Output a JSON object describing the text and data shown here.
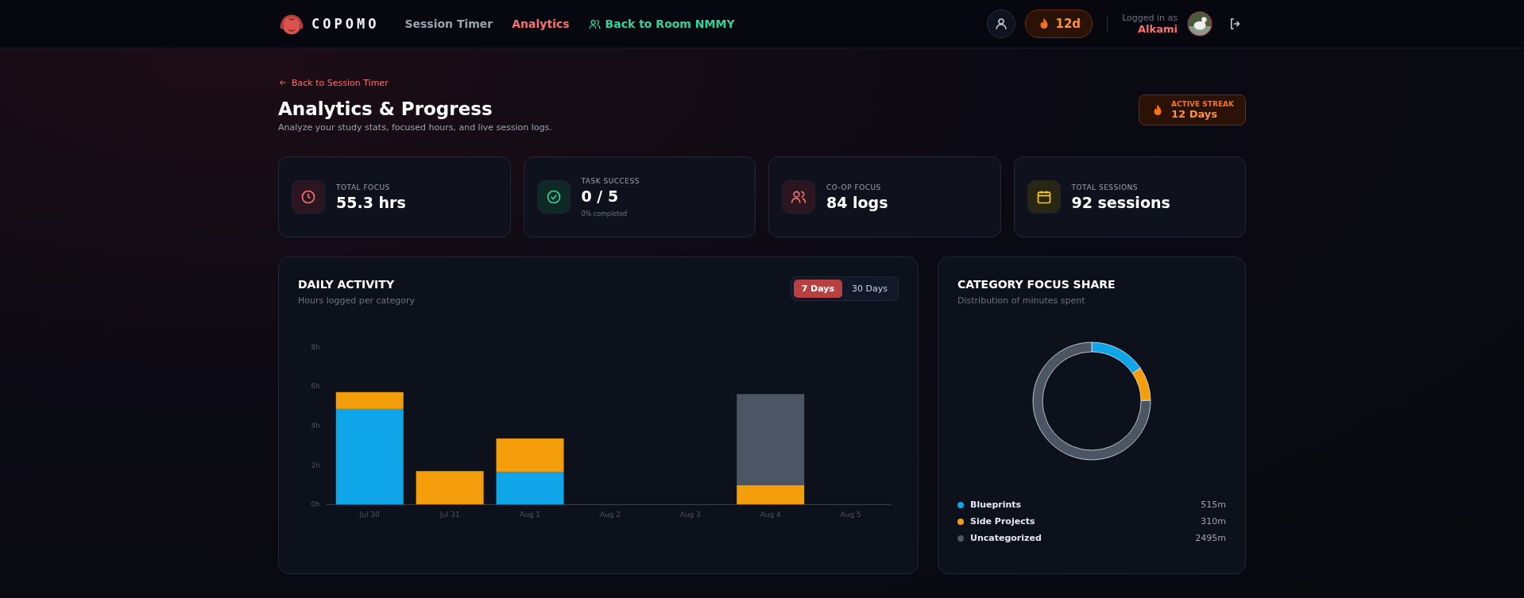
{
  "header": {
    "brand": "COPOMO",
    "nav": [
      {
        "label": "Session Timer",
        "kind": "link",
        "selected": false
      },
      {
        "label": "Analytics",
        "kind": "link",
        "selected": true
      },
      {
        "label": "Back to Room NMMY",
        "kind": "room",
        "selected": false
      }
    ],
    "streak_badge": "12d",
    "logged_in_label": "Logged in as",
    "username": "Alkami"
  },
  "page": {
    "back_link": "Back to Session Timer",
    "title": "Analytics & Progress",
    "subtitle": "Analyze your study stats, focused hours, and live session logs.",
    "streak": {
      "label": "ACTIVE STREAK",
      "value": "12 Days"
    }
  },
  "stats": [
    {
      "kind": "clock",
      "label": "TOTAL FOCUS",
      "value": "55.3 hrs"
    },
    {
      "kind": "check",
      "label": "TASK SUCCESS",
      "value": "0 / 5",
      "note": "0% completed"
    },
    {
      "kind": "users",
      "label": "CO-OP FOCUS",
      "value": "84 logs"
    },
    {
      "kind": "calendar",
      "label": "TOTAL SESSIONS",
      "value": "92 sessions"
    }
  ],
  "daily_activity": {
    "title": "DAILY ACTIVITY",
    "subtitle": "Hours logged per category",
    "ranges": [
      {
        "label": "7 Days",
        "selected": true
      },
      {
        "label": "30 Days",
        "selected": false
      }
    ],
    "chart_data": {
      "type": "bar",
      "stacked": true,
      "categories": [
        "Jul 30",
        "Jul 31",
        "Aug 1",
        "Aug 2",
        "Aug 3",
        "Aug 4",
        "Aug 5"
      ],
      "yticks": [
        {
          "value": 0,
          "label": "0h"
        },
        {
          "value": 2,
          "label": "2h"
        },
        {
          "value": 4,
          "label": "4h"
        },
        {
          "value": 6,
          "label": "6h"
        },
        {
          "value": 8,
          "label": "8h"
        }
      ],
      "ylim": [
        0,
        8
      ],
      "series": [
        {
          "color": "#0ea5e9",
          "values": [
            4.85,
            0,
            1.65,
            0,
            0,
            0,
            0
          ]
        },
        {
          "color": "#f59e0b",
          "values": [
            0.85,
            1.7,
            1.7,
            0,
            0,
            1.0,
            0
          ]
        },
        {
          "color": "#4b5563",
          "values": [
            0,
            0,
            0,
            0,
            0,
            4.6,
            0
          ]
        }
      ]
    }
  },
  "category_share": {
    "title": "CATEGORY FOCUS SHARE",
    "subtitle": "Distribution of minutes spent",
    "legend": [
      {
        "name": "Blueprints",
        "value": "515m",
        "color": "#0ea5e9"
      },
      {
        "name": "Side Projects",
        "value": "310m",
        "color": "#f59e0b"
      },
      {
        "name": "Uncategorized",
        "value": "2495m",
        "color": "#4b5563"
      }
    ]
  }
}
